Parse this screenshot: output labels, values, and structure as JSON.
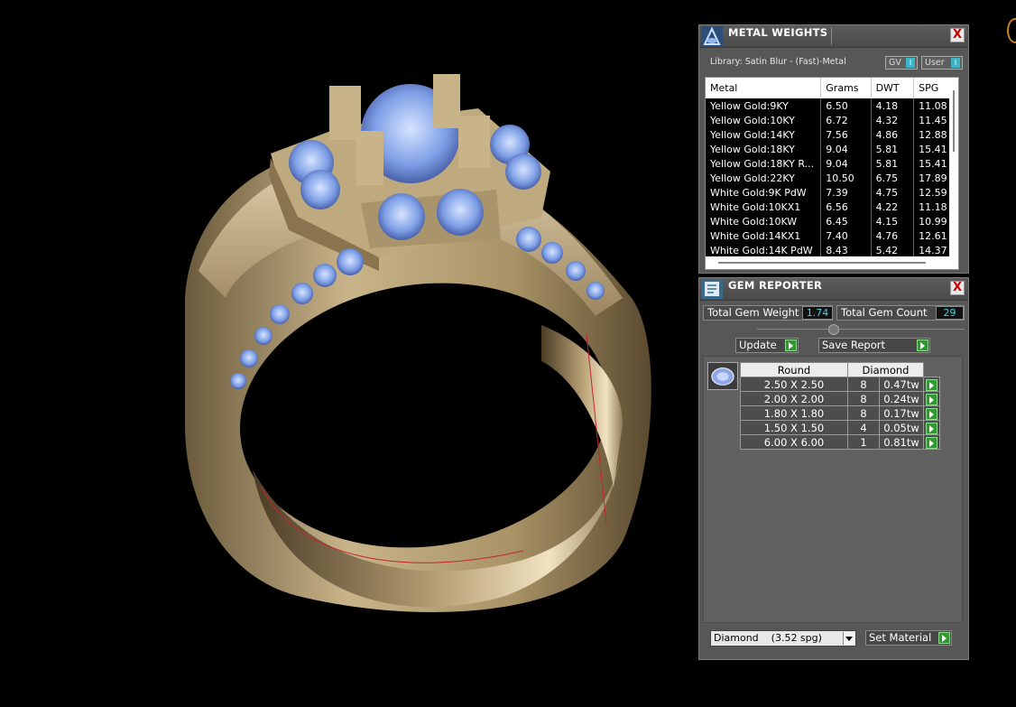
{
  "metal_panel": {
    "title": "METAL WEIGHTS",
    "close": "X",
    "library": "Library: Satin Blur - (Fast)-Metal",
    "toggles": [
      {
        "label": "GV",
        "indicator": "I"
      },
      {
        "label": "User",
        "indicator": "I"
      }
    ],
    "columns": [
      "Metal",
      "Grams",
      "DWT",
      "SPG"
    ],
    "rows": [
      {
        "metal": "Yellow Gold:9KY",
        "grams": "6.50",
        "dwt": "4.18",
        "spg": "11.08"
      },
      {
        "metal": "Yellow Gold:10KY",
        "grams": "6.72",
        "dwt": "4.32",
        "spg": "11.45"
      },
      {
        "metal": "Yellow Gold:14KY",
        "grams": "7.56",
        "dwt": "4.86",
        "spg": "12.88"
      },
      {
        "metal": "Yellow Gold:18KY",
        "grams": "9.04",
        "dwt": "5.81",
        "spg": "15.41"
      },
      {
        "metal": "Yellow Gold:18KY R...",
        "grams": "9.04",
        "dwt": "5.81",
        "spg": "15.41"
      },
      {
        "metal": "Yellow Gold:22KY",
        "grams": "10.50",
        "dwt": "6.75",
        "spg": "17.89"
      },
      {
        "metal": "White Gold:9K PdW",
        "grams": "7.39",
        "dwt": "4.75",
        "spg": "12.59"
      },
      {
        "metal": "White Gold:10KX1",
        "grams": "6.56",
        "dwt": "4.22",
        "spg": "11.18"
      },
      {
        "metal": "White Gold:10KW",
        "grams": "6.45",
        "dwt": "4.15",
        "spg": "10.99"
      },
      {
        "metal": "White Gold:14KX1",
        "grams": "7.40",
        "dwt": "4.76",
        "spg": "12.61"
      },
      {
        "metal": "White Gold:14K PdW",
        "grams": "8.43",
        "dwt": "5.42",
        "spg": "14.37"
      }
    ]
  },
  "gem_panel": {
    "title": "GEM REPORTER",
    "close": "X",
    "total_weight_label": "Total Gem Weight",
    "total_weight_value": "1.74",
    "total_count_label": "Total Gem Count",
    "total_count_value": "29",
    "update_label": "Update",
    "save_report_label": "Save Report",
    "table_headers": [
      "Round",
      "Diamond"
    ],
    "gems": [
      {
        "size": "2.50 X 2.50",
        "count": "8",
        "tw": "0.47tw"
      },
      {
        "size": "2.00 X 2.00",
        "count": "8",
        "tw": "0.24tw"
      },
      {
        "size": "1.80 X 1.80",
        "count": "8",
        "tw": "0.17tw"
      },
      {
        "size": "1.50 X 1.50",
        "count": "4",
        "tw": "0.05tw"
      },
      {
        "size": "6.00 X 6.00",
        "count": "1",
        "tw": "0.81tw"
      }
    ],
    "material_select": "Diamond    (3.52 spg)",
    "set_material_label": "Set Material"
  },
  "colors": {
    "background": "#000000",
    "panel": "#575757",
    "accent_cyan": "#4fd1e0",
    "go_green": "#2f9a2f",
    "gold": "#c9b48a",
    "gem_blue": "#8fb6f0"
  }
}
